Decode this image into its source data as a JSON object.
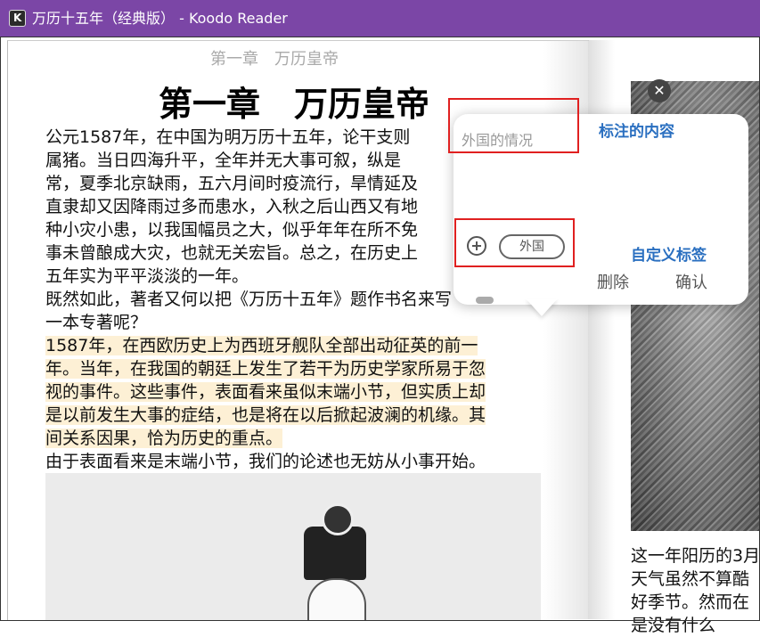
{
  "window": {
    "app_icon_letter": "K",
    "title": "万历十五年（经典版） - Koodo Reader"
  },
  "book": {
    "running_header": "第一章　万历皇帝",
    "chapter_title": "第一章　万历皇帝",
    "paragraph1_lines": [
      "公元1587年，在中国为明万历十五年，论干支则",
      "属猪。当日四海升平，全年并无大事可叙，纵是",
      "常，夏季北京缺雨，五六月间时疫流行，旱情延及",
      "直隶却又因降雨过多而患水，入秋之后山西又有地",
      "种小灾小患，以我国幅员之大，似乎年年在所不免",
      "事未曾酿成大灾，也就无关宏旨。总之，在历史上",
      "五年实为平平淡淡的一年。"
    ],
    "paragraph2_lines": [
      "既然如此，著者又何以把《万历十五年》题作书名来写",
      "一本专著呢？"
    ],
    "highlighted_lines": [
      "1587年，在西欧历史上为西班牙舰队全部出动征英的前一",
      "年。当年，在我国的朝廷上发生了若干为历史学家所易于忽",
      "视的事件。这些事件，表面看来虽似末端小节，但实质上却",
      "是以前发生大事的症结，也是将在以后掀起波澜的机缘。其",
      "间关系因果，恰为历史的重点。"
    ],
    "paragraph4": "由于表面看来是末端小节，我们的论述也无妨从小事开始。",
    "right_page_lines": [
      "这一年阳历的3月",
      "天气虽然不算酷",
      "好季节。然而在",
      "是没有什么"
    ]
  },
  "popup": {
    "note_placeholder": "外国的情况",
    "annotation_label": "标注的内容",
    "custom_tag_label": "自定义标签",
    "tag_chip": "外国",
    "delete_label": "删除",
    "confirm_label": "确认",
    "close_symbol": "✕"
  },
  "colors": {
    "titlebar": "#7b46a6",
    "accent": "#2a6fc0",
    "highlight": "#fdf0d5",
    "annotation_box": "#e02020"
  }
}
